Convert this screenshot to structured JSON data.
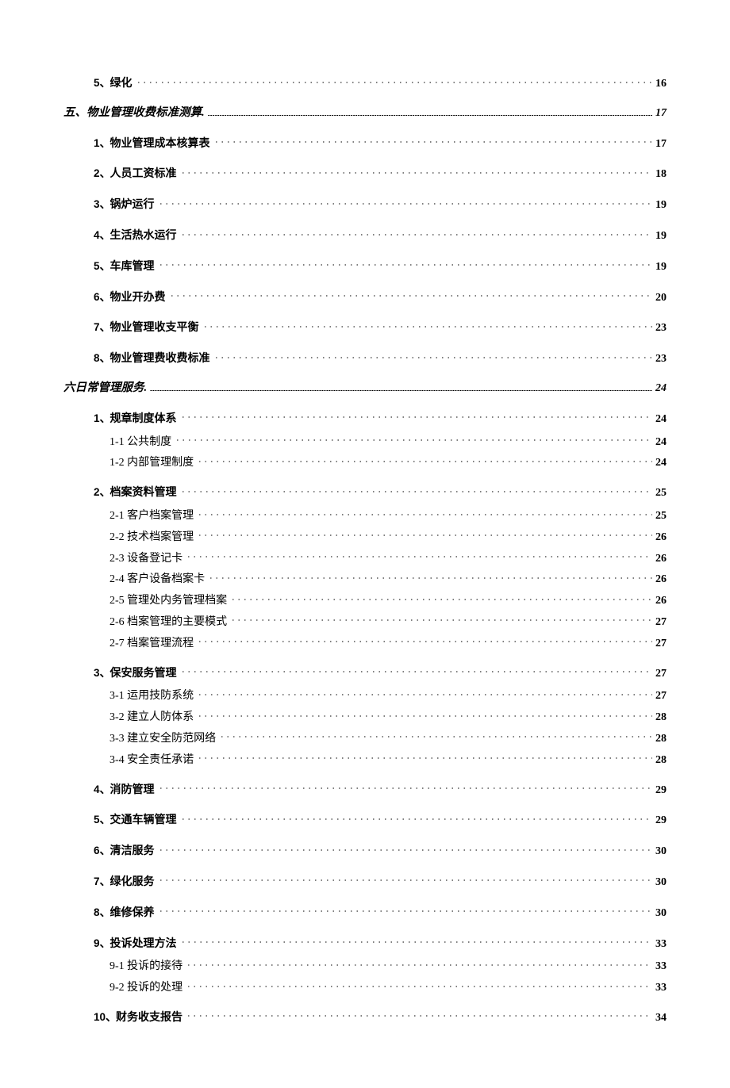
{
  "toc": [
    {
      "kind": "item",
      "num": "5",
      "text": "绿化",
      "page": "16"
    },
    {
      "kind": "section",
      "num": "五、",
      "text": "物业管理收费标准测算",
      "page": "17",
      "trail": "."
    },
    {
      "kind": "item",
      "num": "1",
      "text": "物业管理成本核算表",
      "page": "17"
    },
    {
      "kind": "item",
      "num": "2",
      "text": "人员工资标准",
      "page": "18"
    },
    {
      "kind": "item",
      "num": "3",
      "text": "锅炉运行",
      "page": "19"
    },
    {
      "kind": "item",
      "num": "4",
      "text": "生活热水运行",
      "page": "19"
    },
    {
      "kind": "item",
      "num": "5",
      "text": "车库管理",
      "page": "19"
    },
    {
      "kind": "item",
      "num": "6",
      "text": "物业开办费",
      "page": "20"
    },
    {
      "kind": "item",
      "num": "7",
      "text": "物业管理收支平衡",
      "page": "23"
    },
    {
      "kind": "item",
      "num": "8",
      "text": "物业管理费收费标准",
      "page": "23"
    },
    {
      "kind": "section",
      "num": "",
      "text": "六日常管理服务",
      "page": "24",
      "trail": "."
    },
    {
      "kind": "item",
      "num": "1",
      "text": "规章制度体系",
      "page": "24",
      "sub": [
        {
          "text": "1-1 公共制度",
          "page": "24"
        },
        {
          "text": "1-2 内部管理制度",
          "page": "24"
        }
      ]
    },
    {
      "kind": "item",
      "num": "2",
      "text": "档案资料管理",
      "page": "25",
      "sub": [
        {
          "text": "2-1 客户档案管理",
          "page": "25"
        },
        {
          "text": "2-2 技术档案管理",
          "page": "26"
        },
        {
          "text": "2-3 设备登记卡",
          "page": "26"
        },
        {
          "text": "2-4 客户设备档案卡",
          "page": "26"
        },
        {
          "text": "2-5 管理处内务管理档案",
          "page": "26"
        },
        {
          "text": "2-6 档案管理的主要模式",
          "page": "27"
        },
        {
          "text": "2-7 档案管理流程",
          "page": "27"
        }
      ]
    },
    {
      "kind": "item",
      "num": "3",
      "text": "保安服务管理",
      "page": "27",
      "sub": [
        {
          "text": "3-1 运用技防系统",
          "page": "27"
        },
        {
          "text": "3-2 建立人防体系",
          "page": "28"
        },
        {
          "text": "3-3 建立安全防范网络",
          "page": "28"
        },
        {
          "text": "3-4 安全责任承诺",
          "page": "28"
        }
      ]
    },
    {
      "kind": "item",
      "num": "4",
      "text": "消防管理",
      "page": "29"
    },
    {
      "kind": "item",
      "num": "5",
      "text": "交通车辆管理",
      "page": "29"
    },
    {
      "kind": "item",
      "num": "6",
      "text": "清洁服务",
      "page": "30"
    },
    {
      "kind": "item",
      "num": "7",
      "text": "绿化服务",
      "page": "30"
    },
    {
      "kind": "item",
      "num": "8",
      "text": "维修保养",
      "page": "30"
    },
    {
      "kind": "item",
      "num": "9",
      "text": "投诉处理方法",
      "page": "33",
      "sub": [
        {
          "text": "9-1 投诉的接待",
          "page": "33"
        },
        {
          "text": "9-2 投诉的处理",
          "page": "33"
        }
      ]
    },
    {
      "kind": "item",
      "num": "10",
      "text": "财务收支报告",
      "page": "34"
    }
  ]
}
